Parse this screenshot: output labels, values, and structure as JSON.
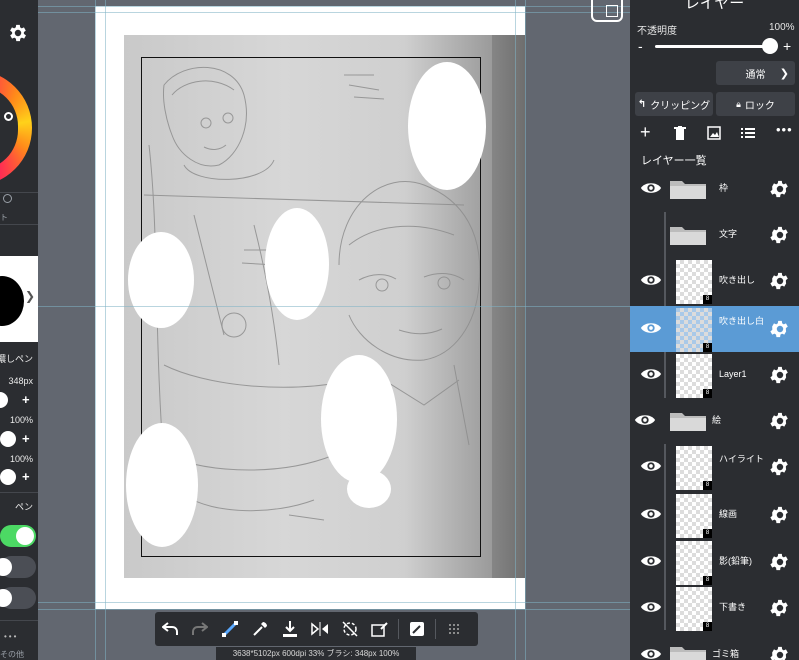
{
  "left_panel": {
    "faint_label_1": "ト",
    "brush_name": "濃しペン",
    "brush_size": "348px",
    "opacity_1": "100%",
    "opacity_2": "100%",
    "pen_label": "ペン",
    "bottom_label": "その他",
    "toggle_1_on": true
  },
  "canvas": {
    "status_text": "3638*5102px 600dpi 33% ブラシ: 348px 100%"
  },
  "toolbar": {
    "items": [
      "undo-icon",
      "redo-icon",
      "transform-icon",
      "eyedropper-icon",
      "download-icon",
      "flip-icon",
      "rotate-icon",
      "eraser-icon",
      "edit-icon",
      "grid-menu-icon"
    ]
  },
  "layer_panel": {
    "title": "レイヤー",
    "opacity_label": "不透明度",
    "opacity_value": "100%",
    "minus": "-",
    "plus": "+",
    "blend_mode": "通常",
    "clipping_label": "クリッピング",
    "lock_label": "ロック",
    "list_title": "レイヤー一覧",
    "layers": [
      {
        "name": "枠",
        "type": "folder",
        "visible": true,
        "selected": false
      },
      {
        "name": "文字",
        "type": "folder",
        "visible": false,
        "selected": false
      },
      {
        "name": "吹き出し",
        "type": "layer",
        "visible": true,
        "selected": false
      },
      {
        "name": "吹き出し白",
        "type": "layer",
        "visible": true,
        "selected": true
      },
      {
        "name": "Layer1",
        "type": "layer",
        "visible": true,
        "selected": false
      },
      {
        "name": "絵",
        "type": "folder",
        "visible": true,
        "selected": false
      },
      {
        "name": "ハイライト",
        "type": "layer",
        "visible": true,
        "selected": false
      },
      {
        "name": "線画",
        "type": "layer",
        "visible": true,
        "selected": false
      },
      {
        "name": "影(鉛筆)",
        "type": "layer",
        "visible": true,
        "selected": false
      },
      {
        "name": "下書き",
        "type": "layer",
        "visible": true,
        "selected": false
      },
      {
        "name": "ゴミ箱",
        "type": "folder",
        "visible": true,
        "selected": false
      }
    ]
  },
  "colors": {
    "panel_bg": "#2b2d31",
    "canvas_bg": "#626770",
    "selected_layer": "#5b9bd5",
    "toggle_on": "#4cd964"
  }
}
